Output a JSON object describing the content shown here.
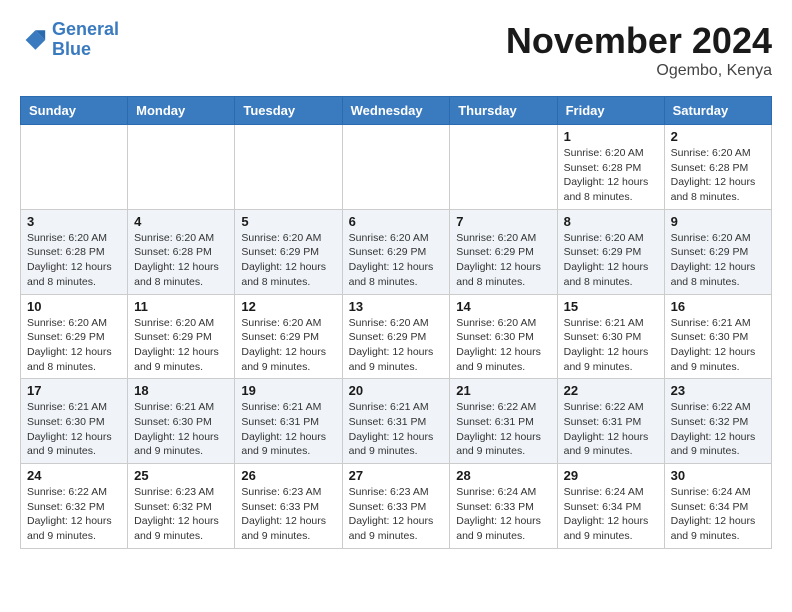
{
  "logo": {
    "text_general": "General",
    "text_blue": "Blue"
  },
  "header": {
    "month": "November 2024",
    "location": "Ogembo, Kenya"
  },
  "days_of_week": [
    "Sunday",
    "Monday",
    "Tuesday",
    "Wednesday",
    "Thursday",
    "Friday",
    "Saturday"
  ],
  "weeks": [
    [
      {
        "day": "",
        "info": ""
      },
      {
        "day": "",
        "info": ""
      },
      {
        "day": "",
        "info": ""
      },
      {
        "day": "",
        "info": ""
      },
      {
        "day": "",
        "info": ""
      },
      {
        "day": "1",
        "info": "Sunrise: 6:20 AM\nSunset: 6:28 PM\nDaylight: 12 hours and 8 minutes."
      },
      {
        "day": "2",
        "info": "Sunrise: 6:20 AM\nSunset: 6:28 PM\nDaylight: 12 hours and 8 minutes."
      }
    ],
    [
      {
        "day": "3",
        "info": "Sunrise: 6:20 AM\nSunset: 6:28 PM\nDaylight: 12 hours and 8 minutes."
      },
      {
        "day": "4",
        "info": "Sunrise: 6:20 AM\nSunset: 6:28 PM\nDaylight: 12 hours and 8 minutes."
      },
      {
        "day": "5",
        "info": "Sunrise: 6:20 AM\nSunset: 6:29 PM\nDaylight: 12 hours and 8 minutes."
      },
      {
        "day": "6",
        "info": "Sunrise: 6:20 AM\nSunset: 6:29 PM\nDaylight: 12 hours and 8 minutes."
      },
      {
        "day": "7",
        "info": "Sunrise: 6:20 AM\nSunset: 6:29 PM\nDaylight: 12 hours and 8 minutes."
      },
      {
        "day": "8",
        "info": "Sunrise: 6:20 AM\nSunset: 6:29 PM\nDaylight: 12 hours and 8 minutes."
      },
      {
        "day": "9",
        "info": "Sunrise: 6:20 AM\nSunset: 6:29 PM\nDaylight: 12 hours and 8 minutes."
      }
    ],
    [
      {
        "day": "10",
        "info": "Sunrise: 6:20 AM\nSunset: 6:29 PM\nDaylight: 12 hours and 8 minutes."
      },
      {
        "day": "11",
        "info": "Sunrise: 6:20 AM\nSunset: 6:29 PM\nDaylight: 12 hours and 9 minutes."
      },
      {
        "day": "12",
        "info": "Sunrise: 6:20 AM\nSunset: 6:29 PM\nDaylight: 12 hours and 9 minutes."
      },
      {
        "day": "13",
        "info": "Sunrise: 6:20 AM\nSunset: 6:29 PM\nDaylight: 12 hours and 9 minutes."
      },
      {
        "day": "14",
        "info": "Sunrise: 6:20 AM\nSunset: 6:30 PM\nDaylight: 12 hours and 9 minutes."
      },
      {
        "day": "15",
        "info": "Sunrise: 6:21 AM\nSunset: 6:30 PM\nDaylight: 12 hours and 9 minutes."
      },
      {
        "day": "16",
        "info": "Sunrise: 6:21 AM\nSunset: 6:30 PM\nDaylight: 12 hours and 9 minutes."
      }
    ],
    [
      {
        "day": "17",
        "info": "Sunrise: 6:21 AM\nSunset: 6:30 PM\nDaylight: 12 hours and 9 minutes."
      },
      {
        "day": "18",
        "info": "Sunrise: 6:21 AM\nSunset: 6:30 PM\nDaylight: 12 hours and 9 minutes."
      },
      {
        "day": "19",
        "info": "Sunrise: 6:21 AM\nSunset: 6:31 PM\nDaylight: 12 hours and 9 minutes."
      },
      {
        "day": "20",
        "info": "Sunrise: 6:21 AM\nSunset: 6:31 PM\nDaylight: 12 hours and 9 minutes."
      },
      {
        "day": "21",
        "info": "Sunrise: 6:22 AM\nSunset: 6:31 PM\nDaylight: 12 hours and 9 minutes."
      },
      {
        "day": "22",
        "info": "Sunrise: 6:22 AM\nSunset: 6:31 PM\nDaylight: 12 hours and 9 minutes."
      },
      {
        "day": "23",
        "info": "Sunrise: 6:22 AM\nSunset: 6:32 PM\nDaylight: 12 hours and 9 minutes."
      }
    ],
    [
      {
        "day": "24",
        "info": "Sunrise: 6:22 AM\nSunset: 6:32 PM\nDaylight: 12 hours and 9 minutes."
      },
      {
        "day": "25",
        "info": "Sunrise: 6:23 AM\nSunset: 6:32 PM\nDaylight: 12 hours and 9 minutes."
      },
      {
        "day": "26",
        "info": "Sunrise: 6:23 AM\nSunset: 6:33 PM\nDaylight: 12 hours and 9 minutes."
      },
      {
        "day": "27",
        "info": "Sunrise: 6:23 AM\nSunset: 6:33 PM\nDaylight: 12 hours and 9 minutes."
      },
      {
        "day": "28",
        "info": "Sunrise: 6:24 AM\nSunset: 6:33 PM\nDaylight: 12 hours and 9 minutes."
      },
      {
        "day": "29",
        "info": "Sunrise: 6:24 AM\nSunset: 6:34 PM\nDaylight: 12 hours and 9 minutes."
      },
      {
        "day": "30",
        "info": "Sunrise: 6:24 AM\nSunset: 6:34 PM\nDaylight: 12 hours and 9 minutes."
      }
    ]
  ]
}
